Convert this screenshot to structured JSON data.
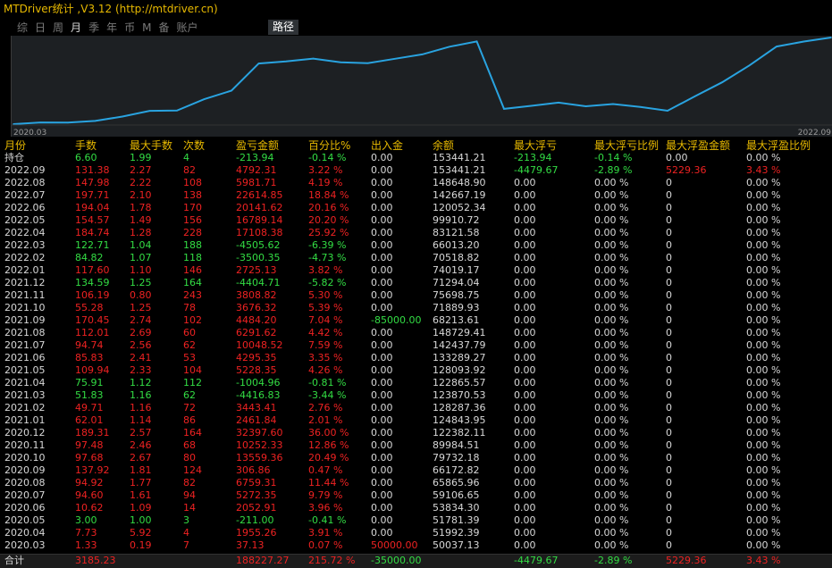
{
  "window": {
    "title": "MTDriver统计 ,V3.12 (http://mtdriver.cn)"
  },
  "periods": [
    {
      "label": "综",
      "active": false
    },
    {
      "label": "日",
      "active": false
    },
    {
      "label": "周",
      "active": false
    },
    {
      "label": "月",
      "active": true
    },
    {
      "label": "季",
      "active": false
    },
    {
      "label": "年",
      "active": false
    },
    {
      "label": "币",
      "active": false
    },
    {
      "label": "M",
      "active": false
    },
    {
      "label": "备",
      "active": false
    },
    {
      "label": "账户",
      "active": false
    }
  ],
  "path_tab": "路径",
  "chart_data": {
    "type": "line",
    "x_start_label": "2020.03",
    "x_end_label": "2022.09",
    "x": [
      "2020.03",
      "2020.04",
      "2020.05",
      "2020.06",
      "2020.07",
      "2020.08",
      "2020.09",
      "2020.10",
      "2020.11",
      "2020.12",
      "2021.01",
      "2021.02",
      "2021.03",
      "2021.04",
      "2021.05",
      "2021.06",
      "2021.07",
      "2021.08",
      "2021.09",
      "2021.10",
      "2021.11",
      "2021.12",
      "2022.01",
      "2022.02",
      "2022.03",
      "2022.04",
      "2022.05",
      "2022.06",
      "2022.07",
      "2022.08",
      "2022.09"
    ],
    "values": [
      50037.13,
      51992.39,
      51781.39,
      53834.3,
      59106.65,
      65865.96,
      66172.82,
      79732.18,
      89984.51,
      122382.11,
      124843.95,
      128287.36,
      123870.53,
      122865.57,
      128093.92,
      133289.27,
      142437.79,
      148729.41,
      68213.61,
      71889.93,
      75698.75,
      71294.04,
      74019.17,
      70518.82,
      66013.2,
      83121.58,
      99910.72,
      120052.34,
      142667.19,
      148648.9,
      153441.21
    ],
    "ylim": [
      50000,
      153441.21
    ],
    "line_color": "#29a3e0"
  },
  "table": {
    "headers": [
      "月份",
      "手数",
      "最大手数",
      "次数",
      "盈亏金额",
      "百分比%",
      "出入金",
      "余额",
      "最大浮亏",
      "最大浮亏比例",
      "最大浮盈金额",
      "最大浮盈比例"
    ],
    "rows": [
      {
        "cells": [
          "持仓",
          "6.60",
          "1.99",
          "4",
          "-213.94",
          "-0.14 %",
          "0.00",
          "153441.21",
          "-213.94",
          "-0.14 %",
          "0.00",
          "0.00 %"
        ],
        "colors": [
          "w",
          "g",
          "g",
          "g",
          "g",
          "g",
          "w",
          "w",
          "g",
          "g",
          "w",
          "w"
        ]
      },
      {
        "cells": [
          "2022.09",
          "131.38",
          "2.27",
          "82",
          "4792.31",
          "3.22 %",
          "0.00",
          "153441.21",
          "-4479.67",
          "-2.89 %",
          "5229.36",
          "3.43 %"
        ],
        "colors": [
          "w",
          "r",
          "r",
          "r",
          "r",
          "r",
          "w",
          "w",
          "g",
          "g",
          "r",
          "r"
        ]
      },
      {
        "cells": [
          "2022.08",
          "147.98",
          "2.22",
          "108",
          "5981.71",
          "4.19 %",
          "0.00",
          "148648.90",
          "0.00",
          "0.00 %",
          "0",
          "0.00 %"
        ],
        "colors": [
          "w",
          "r",
          "r",
          "r",
          "r",
          "r",
          "w",
          "w",
          "w",
          "w",
          "w",
          "w"
        ]
      },
      {
        "cells": [
          "2022.07",
          "197.71",
          "2.10",
          "138",
          "22614.85",
          "18.84 %",
          "0.00",
          "142667.19",
          "0.00",
          "0.00 %",
          "0",
          "0.00 %"
        ],
        "colors": [
          "w",
          "r",
          "r",
          "r",
          "r",
          "r",
          "w",
          "w",
          "w",
          "w",
          "w",
          "w"
        ]
      },
      {
        "cells": [
          "2022.06",
          "194.04",
          "1.78",
          "170",
          "20141.62",
          "20.16 %",
          "0.00",
          "120052.34",
          "0.00",
          "0.00 %",
          "0",
          "0.00 %"
        ],
        "colors": [
          "w",
          "r",
          "r",
          "r",
          "r",
          "r",
          "w",
          "w",
          "w",
          "w",
          "w",
          "w"
        ]
      },
      {
        "cells": [
          "2022.05",
          "154.57",
          "1.49",
          "156",
          "16789.14",
          "20.20 %",
          "0.00",
          "99910.72",
          "0.00",
          "0.00 %",
          "0",
          "0.00 %"
        ],
        "colors": [
          "w",
          "r",
          "r",
          "r",
          "r",
          "r",
          "w",
          "w",
          "w",
          "w",
          "w",
          "w"
        ]
      },
      {
        "cells": [
          "2022.04",
          "184.74",
          "1.28",
          "228",
          "17108.38",
          "25.92 %",
          "0.00",
          "83121.58",
          "0.00",
          "0.00 %",
          "0",
          "0.00 %"
        ],
        "colors": [
          "w",
          "r",
          "r",
          "r",
          "r",
          "r",
          "w",
          "w",
          "w",
          "w",
          "w",
          "w"
        ]
      },
      {
        "cells": [
          "2022.03",
          "122.71",
          "1.04",
          "188",
          "-4505.62",
          "-6.39 %",
          "0.00",
          "66013.20",
          "0.00",
          "0.00 %",
          "0",
          "0.00 %"
        ],
        "colors": [
          "w",
          "g",
          "g",
          "g",
          "g",
          "g",
          "w",
          "w",
          "w",
          "w",
          "w",
          "w"
        ]
      },
      {
        "cells": [
          "2022.02",
          "84.82",
          "1.07",
          "118",
          "-3500.35",
          "-4.73 %",
          "0.00",
          "70518.82",
          "0.00",
          "0.00 %",
          "0",
          "0.00 %"
        ],
        "colors": [
          "w",
          "g",
          "g",
          "g",
          "g",
          "g",
          "w",
          "w",
          "w",
          "w",
          "w",
          "w"
        ]
      },
      {
        "cells": [
          "2022.01",
          "117.60",
          "1.10",
          "146",
          "2725.13",
          "3.82 %",
          "0.00",
          "74019.17",
          "0.00",
          "0.00 %",
          "0",
          "0.00 %"
        ],
        "colors": [
          "w",
          "r",
          "r",
          "r",
          "r",
          "r",
          "w",
          "w",
          "w",
          "w",
          "w",
          "w"
        ]
      },
      {
        "cells": [
          "2021.12",
          "134.59",
          "1.25",
          "164",
          "-4404.71",
          "-5.82 %",
          "0.00",
          "71294.04",
          "0.00",
          "0.00 %",
          "0",
          "0.00 %"
        ],
        "colors": [
          "w",
          "g",
          "g",
          "g",
          "g",
          "g",
          "w",
          "w",
          "w",
          "w",
          "w",
          "w"
        ]
      },
      {
        "cells": [
          "2021.11",
          "106.19",
          "0.80",
          "243",
          "3808.82",
          "5.30 %",
          "0.00",
          "75698.75",
          "0.00",
          "0.00 %",
          "0",
          "0.00 %"
        ],
        "colors": [
          "w",
          "r",
          "r",
          "r",
          "r",
          "r",
          "w",
          "w",
          "w",
          "w",
          "w",
          "w"
        ]
      },
      {
        "cells": [
          "2021.10",
          "55.28",
          "1.25",
          "78",
          "3676.32",
          "5.39 %",
          "0.00",
          "71889.93",
          "0.00",
          "0.00 %",
          "0",
          "0.00 %"
        ],
        "colors": [
          "w",
          "r",
          "r",
          "r",
          "r",
          "r",
          "w",
          "w",
          "w",
          "w",
          "w",
          "w"
        ]
      },
      {
        "cells": [
          "2021.09",
          "170.45",
          "2.74",
          "102",
          "4484.20",
          "7.04 %",
          "-85000.00",
          "68213.61",
          "0.00",
          "0.00 %",
          "0",
          "0.00 %"
        ],
        "colors": [
          "w",
          "r",
          "r",
          "r",
          "r",
          "r",
          "g",
          "w",
          "w",
          "w",
          "w",
          "w"
        ]
      },
      {
        "cells": [
          "2021.08",
          "112.01",
          "2.69",
          "60",
          "6291.62",
          "4.42 %",
          "0.00",
          "148729.41",
          "0.00",
          "0.00 %",
          "0",
          "0.00 %"
        ],
        "colors": [
          "w",
          "r",
          "r",
          "r",
          "r",
          "r",
          "w",
          "w",
          "w",
          "w",
          "w",
          "w"
        ]
      },
      {
        "cells": [
          "2021.07",
          "94.74",
          "2.56",
          "62",
          "10048.52",
          "7.59 %",
          "0.00",
          "142437.79",
          "0.00",
          "0.00 %",
          "0",
          "0.00 %"
        ],
        "colors": [
          "w",
          "r",
          "r",
          "r",
          "r",
          "r",
          "w",
          "w",
          "w",
          "w",
          "w",
          "w"
        ]
      },
      {
        "cells": [
          "2021.06",
          "85.83",
          "2.41",
          "53",
          "4295.35",
          "3.35 %",
          "0.00",
          "133289.27",
          "0.00",
          "0.00 %",
          "0",
          "0.00 %"
        ],
        "colors": [
          "w",
          "r",
          "r",
          "r",
          "r",
          "r",
          "w",
          "w",
          "w",
          "w",
          "w",
          "w"
        ]
      },
      {
        "cells": [
          "2021.05",
          "109.94",
          "2.33",
          "104",
          "5228.35",
          "4.26 %",
          "0.00",
          "128093.92",
          "0.00",
          "0.00 %",
          "0",
          "0.00 %"
        ],
        "colors": [
          "w",
          "r",
          "r",
          "r",
          "r",
          "r",
          "w",
          "w",
          "w",
          "w",
          "w",
          "w"
        ]
      },
      {
        "cells": [
          "2021.04",
          "75.91",
          "1.12",
          "112",
          "-1004.96",
          "-0.81 %",
          "0.00",
          "122865.57",
          "0.00",
          "0.00 %",
          "0",
          "0.00 %"
        ],
        "colors": [
          "w",
          "g",
          "g",
          "g",
          "g",
          "g",
          "w",
          "w",
          "w",
          "w",
          "w",
          "w"
        ]
      },
      {
        "cells": [
          "2021.03",
          "51.83",
          "1.16",
          "62",
          "-4416.83",
          "-3.44 %",
          "0.00",
          "123870.53",
          "0.00",
          "0.00 %",
          "0",
          "0.00 %"
        ],
        "colors": [
          "w",
          "g",
          "g",
          "g",
          "g",
          "g",
          "w",
          "w",
          "w",
          "w",
          "w",
          "w"
        ]
      },
      {
        "cells": [
          "2021.02",
          "49.71",
          "1.16",
          "72",
          "3443.41",
          "2.76 %",
          "0.00",
          "128287.36",
          "0.00",
          "0.00 %",
          "0",
          "0.00 %"
        ],
        "colors": [
          "w",
          "r",
          "r",
          "r",
          "r",
          "r",
          "w",
          "w",
          "w",
          "w",
          "w",
          "w"
        ]
      },
      {
        "cells": [
          "2021.01",
          "62.01",
          "1.14",
          "86",
          "2461.84",
          "2.01 %",
          "0.00",
          "124843.95",
          "0.00",
          "0.00 %",
          "0",
          "0.00 %"
        ],
        "colors": [
          "w",
          "r",
          "r",
          "r",
          "r",
          "r",
          "w",
          "w",
          "w",
          "w",
          "w",
          "w"
        ]
      },
      {
        "cells": [
          "2020.12",
          "189.31",
          "2.57",
          "164",
          "32397.60",
          "36.00 %",
          "0.00",
          "122382.11",
          "0.00",
          "0.00 %",
          "0",
          "0.00 %"
        ],
        "colors": [
          "w",
          "r",
          "r",
          "r",
          "r",
          "r",
          "w",
          "w",
          "w",
          "w",
          "w",
          "w"
        ]
      },
      {
        "cells": [
          "2020.11",
          "97.48",
          "2.46",
          "68",
          "10252.33",
          "12.86 %",
          "0.00",
          "89984.51",
          "0.00",
          "0.00 %",
          "0",
          "0.00 %"
        ],
        "colors": [
          "w",
          "r",
          "r",
          "r",
          "r",
          "r",
          "w",
          "w",
          "w",
          "w",
          "w",
          "w"
        ]
      },
      {
        "cells": [
          "2020.10",
          "97.68",
          "2.67",
          "80",
          "13559.36",
          "20.49 %",
          "0.00",
          "79732.18",
          "0.00",
          "0.00 %",
          "0",
          "0.00 %"
        ],
        "colors": [
          "w",
          "r",
          "r",
          "r",
          "r",
          "r",
          "w",
          "w",
          "w",
          "w",
          "w",
          "w"
        ]
      },
      {
        "cells": [
          "2020.09",
          "137.92",
          "1.81",
          "124",
          "306.86",
          "0.47 %",
          "0.00",
          "66172.82",
          "0.00",
          "0.00 %",
          "0",
          "0.00 %"
        ],
        "colors": [
          "w",
          "r",
          "r",
          "r",
          "r",
          "r",
          "w",
          "w",
          "w",
          "w",
          "w",
          "w"
        ]
      },
      {
        "cells": [
          "2020.08",
          "94.92",
          "1.77",
          "82",
          "6759.31",
          "11.44 %",
          "0.00",
          "65865.96",
          "0.00",
          "0.00 %",
          "0",
          "0.00 %"
        ],
        "colors": [
          "w",
          "r",
          "r",
          "r",
          "r",
          "r",
          "w",
          "w",
          "w",
          "w",
          "w",
          "w"
        ]
      },
      {
        "cells": [
          "2020.07",
          "94.60",
          "1.61",
          "94",
          "5272.35",
          "9.79 %",
          "0.00",
          "59106.65",
          "0.00",
          "0.00 %",
          "0",
          "0.00 %"
        ],
        "colors": [
          "w",
          "r",
          "r",
          "r",
          "r",
          "r",
          "w",
          "w",
          "w",
          "w",
          "w",
          "w"
        ]
      },
      {
        "cells": [
          "2020.06",
          "10.62",
          "1.09",
          "14",
          "2052.91",
          "3.96 %",
          "0.00",
          "53834.30",
          "0.00",
          "0.00 %",
          "0",
          "0.00 %"
        ],
        "colors": [
          "w",
          "r",
          "r",
          "r",
          "r",
          "r",
          "w",
          "w",
          "w",
          "w",
          "w",
          "w"
        ]
      },
      {
        "cells": [
          "2020.05",
          "3.00",
          "1.00",
          "3",
          "-211.00",
          "-0.41 %",
          "0.00",
          "51781.39",
          "0.00",
          "0.00 %",
          "0",
          "0.00 %"
        ],
        "colors": [
          "w",
          "g",
          "g",
          "g",
          "g",
          "g",
          "w",
          "w",
          "w",
          "w",
          "w",
          "w"
        ]
      },
      {
        "cells": [
          "2020.04",
          "7.73",
          "5.92",
          "4",
          "1955.26",
          "3.91 %",
          "0.00",
          "51992.39",
          "0.00",
          "0.00 %",
          "0",
          "0.00 %"
        ],
        "colors": [
          "w",
          "r",
          "r",
          "r",
          "r",
          "r",
          "w",
          "w",
          "w",
          "w",
          "w",
          "w"
        ]
      },
      {
        "cells": [
          "2020.03",
          "1.33",
          "0.19",
          "7",
          "37.13",
          "0.07 %",
          "50000.00",
          "50037.13",
          "0.00",
          "0.00 %",
          "0",
          "0.00 %"
        ],
        "colors": [
          "w",
          "r",
          "r",
          "r",
          "r",
          "r",
          "r",
          "w",
          "w",
          "w",
          "w",
          "w"
        ]
      }
    ],
    "total": {
      "cells": [
        "合计",
        "3185.23",
        "",
        "",
        "188227.27",
        "215.72 %",
        "-35000.00",
        "",
        "-4479.67",
        "-2.89 %",
        "5229.36",
        "3.43 %"
      ],
      "colors": [
        "w",
        "r",
        "r",
        "r",
        "r",
        "r",
        "g",
        "w",
        "g",
        "g",
        "r",
        "r"
      ]
    }
  },
  "colors": {
    "w": "#d8d8d8",
    "g": "#33dd44",
    "r": "#ee2222",
    "header": "#e6b800"
  }
}
